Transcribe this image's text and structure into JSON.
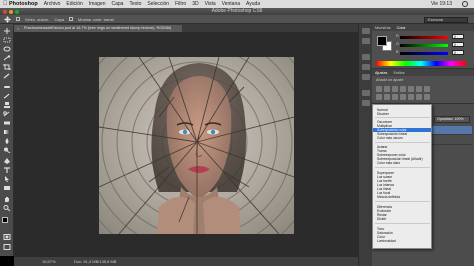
{
  "menubar": {
    "app": "Photoshop",
    "items": [
      "Archivo",
      "Edición",
      "Imagen",
      "Capa",
      "Texto",
      "Selección",
      "Filtro",
      "3D",
      "Vista",
      "Ventana",
      "Ayuda"
    ],
    "clock": "Vie 19:13"
  },
  "titlebar": {
    "title": "Adobe Photoshop CS6"
  },
  "options": {
    "items": [
      "Selec. autom.",
      "Capa",
      "Mostrar contr. transf."
    ],
    "workspace": "Esencial"
  },
  "document": {
    "tab_label": "PracticamedadeEdicion.psd al 16,7% (tree rings on weathered stump texture), RGB/8#)",
    "zoom": "16,67%",
    "doc_size": "Doc: 51,4 MB/135,8 MB"
  },
  "panels": {
    "color_tabs": [
      "Muestras",
      "Color"
    ],
    "sliders": [
      {
        "label": "R",
        "value": "0"
      },
      {
        "label": "G",
        "value": "0"
      },
      {
        "label": "B",
        "value": "0"
      }
    ],
    "adj_tabs": [
      "Ajustes",
      "Estilos"
    ],
    "adj_title": "Añadir un ajuste",
    "opacity": "Opacidad: 100%"
  },
  "blend_menu": {
    "groups": [
      [
        "Normal",
        "Disolver"
      ],
      [
        "Oscurecer",
        "Multiplicar",
        "Subexposición color",
        "Subexposición lineal",
        "Color más oscuro"
      ],
      [
        "Aclarar",
        "Trama",
        "Sobreexponer color",
        "Sobreexposición lineal (Añadir)",
        "Color más claro"
      ],
      [
        "Superponer",
        "Luz suave",
        "Luz fuerte",
        "Luz intensa",
        "Luz lineal",
        "Luz focal",
        "Mezcla definida"
      ],
      [
        "Diferencia",
        "Exclusión",
        "Restar",
        "Dividir"
      ],
      [
        "Tono",
        "Saturación",
        "Color",
        "Luminosidad"
      ]
    ],
    "highlighted": "Subexposición color"
  },
  "colors": {
    "selection": "#2f73d6",
    "panel_bg": "#535353",
    "canvas_bg": "#2b2b2b"
  }
}
